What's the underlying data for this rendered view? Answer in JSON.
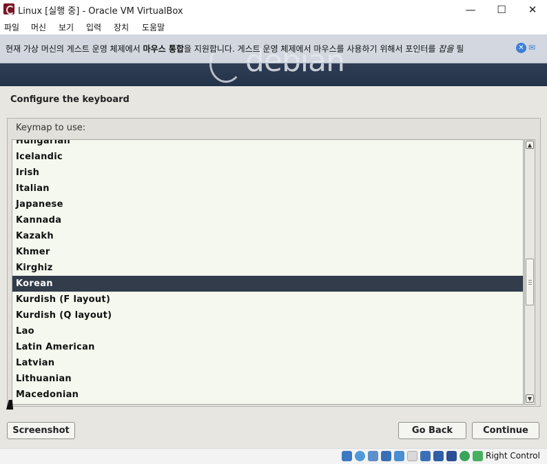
{
  "window": {
    "title": "Linux [실행 중] - Oracle VM VirtualBox",
    "minimize_glyph": "—",
    "maximize_glyph": "☐",
    "close_glyph": "✕"
  },
  "menubar": {
    "items": [
      "파일",
      "머신",
      "보기",
      "입력",
      "장치",
      "도움말"
    ]
  },
  "notification": {
    "text_before": "현재 가상 머신의 게스트 운영 체제에서 ",
    "text_bold": "마우스 통합",
    "text_after": "을 지원합니다. 게스트 운영 체제에서 마우스를 사용하기 위해서 포인터를 ",
    "text_italic": "잡을",
    "text_tail": " 필"
  },
  "installer": {
    "logo_text": "debian",
    "heading": "Configure the keyboard",
    "keymap_label": "Keymap to use:",
    "keymaps": [
      "Hungarian",
      "Icelandic",
      "Irish",
      "Italian",
      "Japanese",
      "Kannada",
      "Kazakh",
      "Khmer",
      "Kirghiz",
      "Korean",
      "Kurdish (F layout)",
      "Kurdish (Q layout)",
      "Lao",
      "Latin American",
      "Latvian",
      "Lithuanian",
      "Macedonian"
    ],
    "selected": "Korean",
    "buttons": {
      "screenshot": "Screenshot",
      "go_back": "Go Back",
      "continue": "Continue"
    }
  },
  "statusbar": {
    "host_key_label": "Right Control",
    "icons": [
      "hard-disk-icon",
      "optical-drive-icon",
      "audio-icon",
      "network-icon",
      "usb-icon",
      "shared-folder-icon",
      "display-icon",
      "video-capture-icon",
      "recording-icon",
      "cpu-icon",
      "mouse-integration-icon"
    ]
  },
  "colors": {
    "banner": "#2c3b52",
    "selection": "#323c4a",
    "list_bg": "#f4f8ef",
    "vm_bg": "#e7e6e1"
  }
}
